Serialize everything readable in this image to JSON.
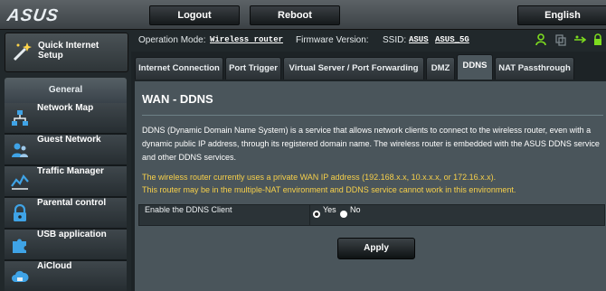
{
  "brand": "ASUS",
  "topbar": {
    "logout_label": "Logout",
    "reboot_label": "Reboot",
    "language_label": "English"
  },
  "sidebar": {
    "quick_setup_label": "Quick Internet Setup",
    "section_label": "General",
    "items": [
      {
        "label": "Network Map",
        "icon": "network-map-icon"
      },
      {
        "label": "Guest Network",
        "icon": "guest-network-icon"
      },
      {
        "label": "Traffic Manager",
        "icon": "traffic-manager-icon"
      },
      {
        "label": "Parental control",
        "icon": "lock-icon"
      },
      {
        "label": "USB application",
        "icon": "puzzle-icon"
      },
      {
        "label": "AiCloud",
        "icon": "cloud-icon"
      }
    ]
  },
  "infobar": {
    "operation_mode_label": "Operation Mode:",
    "operation_mode_value": "Wireless router",
    "firmware_label": "Firmware Version:",
    "ssid_label": "SSID:",
    "ssid_1": "ASUS",
    "ssid_2": "ASUS_5G"
  },
  "tabs": [
    {
      "label": "Internet Connection"
    },
    {
      "label": "Port Trigger"
    },
    {
      "label": "Virtual Server / Port Forwarding"
    },
    {
      "label": "DMZ"
    },
    {
      "label": "DDNS"
    },
    {
      "label": "NAT Passthrough"
    }
  ],
  "active_tab": "DDNS",
  "page": {
    "title": "WAN - DDNS",
    "description": "DDNS (Dynamic Domain Name System) is a service that allows network clients to connect to the wireless router, even with a dynamic public IP address, through its registered domain name. The wireless router is embedded with the ASUS DDNS service and other DDNS services.",
    "warning_line1": "The wireless router currently uses a private WAN IP address (192.168.x.x, 10.x.x.x, or 172.16.x.x).",
    "warning_line2": "This router may be in the multiple-NAT environment and DDNS service cannot work in this environment.",
    "enable_label": "Enable the DDNS Client",
    "yes_label": "Yes",
    "no_label": "No",
    "enabled": "Yes",
    "apply_label": "Apply"
  },
  "colors": {
    "accent_green": "#7ddc1f",
    "warning_yellow": "#f7d04a",
    "panel": "#4a555b"
  }
}
